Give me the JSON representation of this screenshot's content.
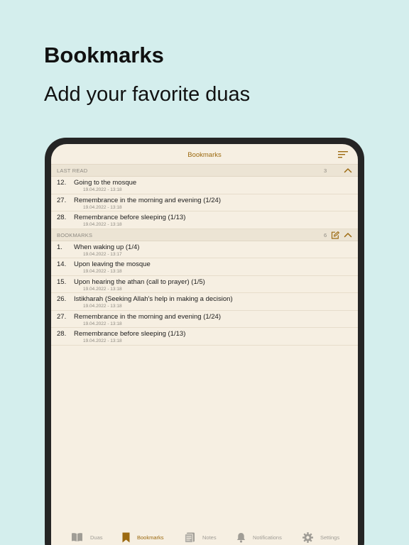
{
  "promo": {
    "title": "Bookmarks",
    "subtitle": "Add your favorite duas"
  },
  "nav": {
    "title": "Bookmarks",
    "sort_icon": "sort-lines-icon"
  },
  "last_read": {
    "label": "LAST READ",
    "count": "3",
    "items": [
      {
        "num": "12.",
        "title": "Going to the mosque",
        "date": "19.04.2022 - 13:18"
      },
      {
        "num": "27.",
        "title": "Remembrance in the morning and evening (1/24)",
        "date": "19.04.2022 - 13:18"
      },
      {
        "num": "28.",
        "title": "Remembrance before sleeping (1/13)",
        "date": "19.04.2022 - 13:18"
      }
    ]
  },
  "bookmarks": {
    "label": "BOOKMARKS",
    "count": "6",
    "items": [
      {
        "num": "1.",
        "title": "When waking up (1/4)",
        "date": "19.04.2022 - 13:17"
      },
      {
        "num": "14.",
        "title": "Upon leaving the mosque",
        "date": "19.04.2022 - 13:18"
      },
      {
        "num": "15.",
        "title": "Upon hearing the athan (call to prayer) (1/5)",
        "date": "19.04.2022 - 13:18"
      },
      {
        "num": "26.",
        "title": "Istikharah (Seeking Allah's help in making a decision)",
        "date": "19.04.2022 - 13:18"
      },
      {
        "num": "27.",
        "title": "Remembrance in the morning and evening (1/24)",
        "date": "19.04.2022 - 13:18"
      },
      {
        "num": "28.",
        "title": "Remembrance before sleeping (1/13)",
        "date": "19.04.2022 - 13:18"
      }
    ]
  },
  "tabs": [
    {
      "label": "Duas",
      "icon": "book-icon"
    },
    {
      "label": "Bookmarks",
      "icon": "bookmark-icon",
      "active": true
    },
    {
      "label": "Notes",
      "icon": "notes-icon"
    },
    {
      "label": "Notifications",
      "icon": "bell-icon"
    },
    {
      "label": "Settings",
      "icon": "gear-icon"
    }
  ],
  "colors": {
    "background": "#d4eeed",
    "screen": "#f6efe2",
    "accent": "#9c6a10",
    "device": "#252525",
    "muted": "#8e8a82"
  }
}
